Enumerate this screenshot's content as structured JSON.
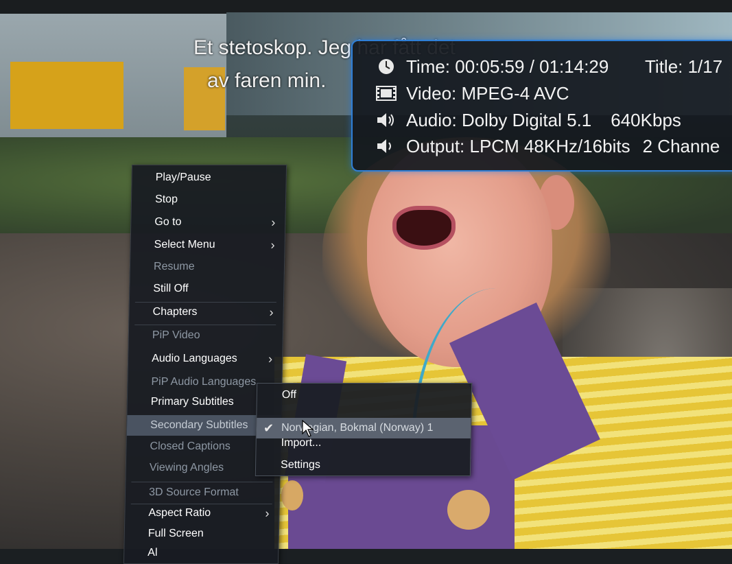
{
  "subtitle": {
    "line1": "Et stetoskop. Jeg har fått det",
    "line2": "av faren min."
  },
  "osd": {
    "time": "Time: 00:05:59 / 01:14:29",
    "title": "Title: 1/17",
    "video": "Video: MPEG-4 AVC",
    "audio": "Audio: Dolby Digital 5.1",
    "audio_bitrate": "640Kbps",
    "output": "Output: LPCM 48KHz/16bits",
    "output_channels": "2 Channe",
    "icons": [
      "clock-icon",
      "film-icon",
      "speaker-icon",
      "speaker-output-icon"
    ],
    "accent": "#2f7fd6"
  },
  "menu": {
    "items": [
      {
        "label": "Play/Pause",
        "state": "enabled"
      },
      {
        "label": "Stop",
        "state": "enabled"
      },
      {
        "label": "Go to",
        "state": "enabled",
        "submenu": true
      },
      {
        "label": "Select Menu",
        "state": "enabled",
        "submenu": true
      },
      {
        "label": "Resume",
        "state": "disabled"
      },
      {
        "label": "Still Off",
        "state": "enabled"
      },
      {
        "label": "Chapters",
        "state": "enabled",
        "submenu": true
      },
      {
        "label": "PiP Video",
        "state": "disabled"
      },
      {
        "label": "Audio Languages",
        "state": "enabled",
        "submenu": true
      },
      {
        "label": "PiP Audio Languages",
        "state": "disabled"
      },
      {
        "label": "Primary Subtitles",
        "state": "enabled"
      },
      {
        "label": "Secondary Subtitles",
        "state": "highlighted"
      },
      {
        "label": "Closed Captions",
        "state": "disabled"
      },
      {
        "label": "Viewing Angles",
        "state": "disabled"
      },
      {
        "label": "3D Source Format",
        "state": "disabled"
      },
      {
        "label": "Aspect Ratio",
        "state": "enabled",
        "submenu": true
      },
      {
        "label": "Full Screen",
        "state": "enabled"
      },
      {
        "label": "Al",
        "state": "enabled"
      }
    ]
  },
  "submenu": {
    "items": [
      {
        "label": "Off",
        "checked": false
      },
      {
        "label": "Norwegian, Bokmal (Norway) 1",
        "checked": true,
        "highlighted": true
      },
      {
        "label": "Import...",
        "checked": false
      },
      {
        "label": "Settings",
        "checked": false
      }
    ]
  }
}
